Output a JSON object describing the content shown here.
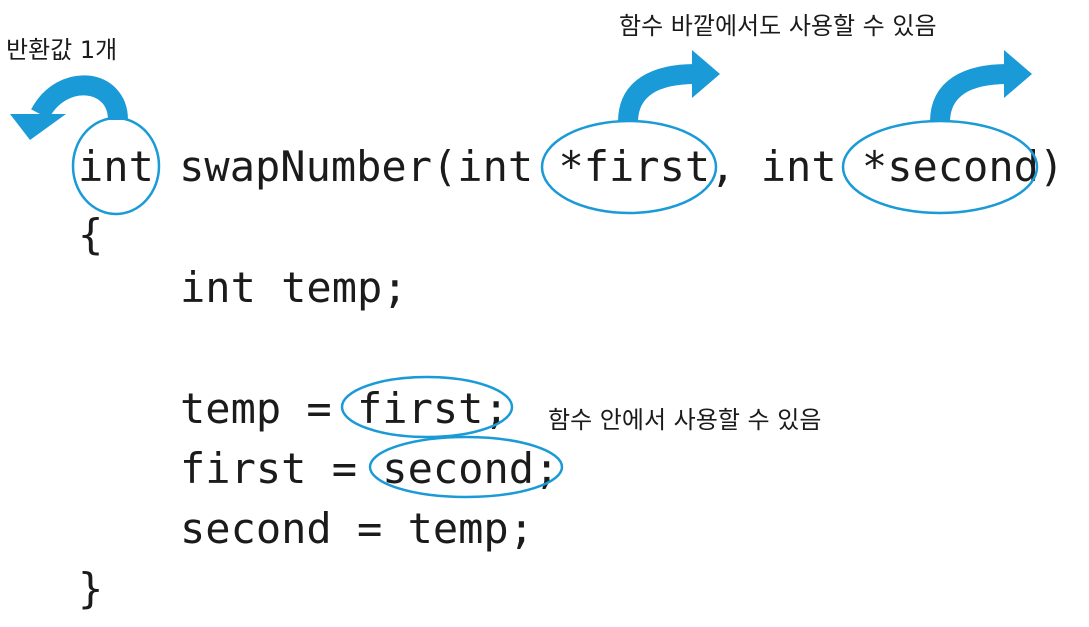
{
  "annotations": {
    "return_value": "반환값 1개",
    "outside_use": "함수 바깥에서도 사용할 수 있음",
    "inside_use": "함수 안에서 사용할 수 있음"
  },
  "code": {
    "ret_type": "int",
    "func_name": " swapNumber(",
    "param1_type": "int ",
    "param1_name": "*first",
    "comma": ",",
    "param2_type": " int ",
    "param2_name": "*second",
    "close_paren": ")",
    "open_brace": "{",
    "decl": "int temp;",
    "line1_lhs": "temp = ",
    "line1_rhs": "first;",
    "line2_lhs": "first = ",
    "line2_rhs": "second;",
    "line3": "second = temp;",
    "close_brace": "}"
  },
  "colors": {
    "accent": "#1a9ad6",
    "text": "#1b1b1b"
  }
}
